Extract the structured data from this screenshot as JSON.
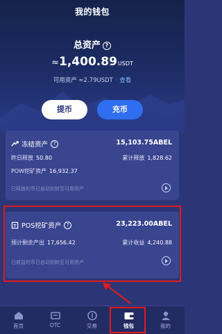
{
  "header": {
    "title": "我的钱包"
  },
  "summary": {
    "total_label": "总资产",
    "help_icon": "?",
    "approx": "≈",
    "total_amount": "1,400.89",
    "total_unit": "USDT",
    "available_label": "可用资产 ≈2.79USDT",
    "view_link": "· 查看"
  },
  "actions": {
    "withdraw": "提币",
    "deposit": "充币"
  },
  "frozen_card": {
    "title": "冻结资产",
    "value": "15,103.75ABEL",
    "yesterday_label": "昨日释放",
    "yesterday_value": "50.80",
    "cumulative_label": "累计释放",
    "cumulative_value": "1,828.62",
    "pow_label": "POW挖矿资产",
    "pow_value": "16,932.37",
    "hint": "已释放的币已自动划转至可用资产"
  },
  "pos_card": {
    "title": "POS挖矿资产",
    "value": "23,223.00ABEL",
    "remaining_label": "预计剩余产出",
    "remaining_value": "17,656.42",
    "income_label": "累计收益",
    "income_value": "4,240.88",
    "hint": "已收益的币已自动划转至可用资产"
  },
  "tabs": [
    {
      "label": "首页",
      "icon": "home-icon"
    },
    {
      "label": "OTC",
      "icon": "otc-icon"
    },
    {
      "label": "交易",
      "icon": "trade-icon"
    },
    {
      "label": "钱包",
      "icon": "wallet-icon",
      "active": true
    },
    {
      "label": "我的",
      "icon": "profile-icon"
    }
  ],
  "colors": {
    "accent": "#2f6ef0",
    "highlight": "#e21b1b",
    "card": "#39458f"
  }
}
